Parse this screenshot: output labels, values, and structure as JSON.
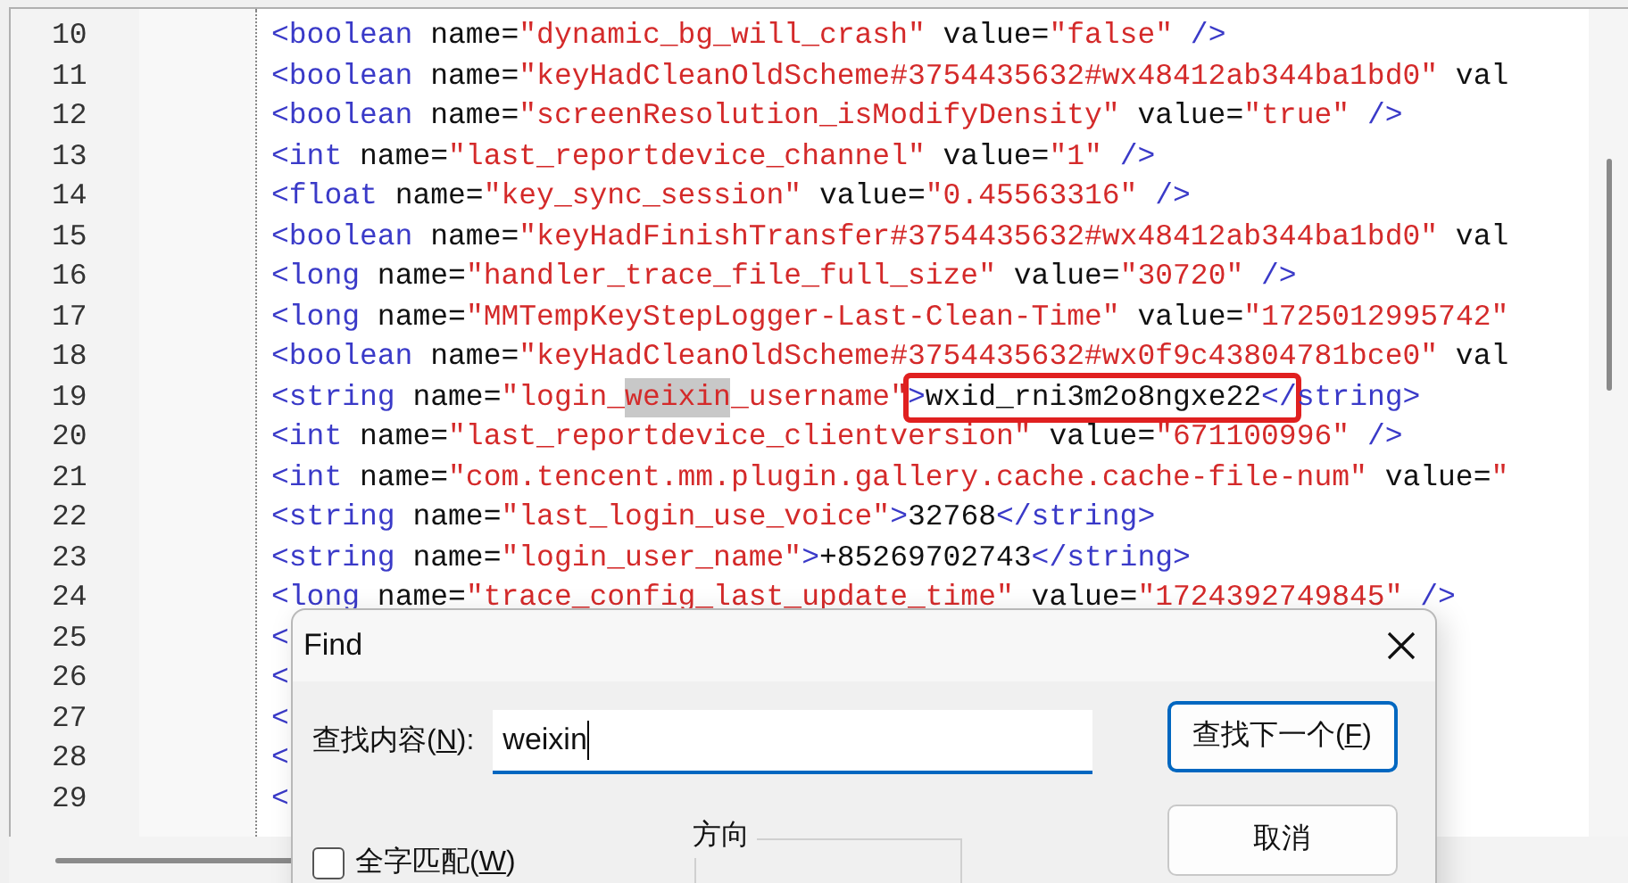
{
  "editor": {
    "lines": [
      {
        "number": "10",
        "parts": [
          {
            "text": "<boolean name=\"dynamic_bg_will_crash\" value=\"false\" />",
            "search_match": false,
            "boxed": false
          }
        ]
      },
      {
        "number": "11",
        "parts": [
          {
            "text": "<boolean name=\"keyHadCleanOldScheme#3754435632#wx48412ab344ba1bd0\" val",
            "search_match": false,
            "boxed": false
          }
        ]
      },
      {
        "number": "12",
        "parts": [
          {
            "text": "<boolean name=\"screenResolution_isModifyDensity\" value=\"true\" />",
            "search_match": false,
            "boxed": false
          }
        ]
      },
      {
        "number": "13",
        "parts": [
          {
            "text": "<int name=\"last_reportdevice_channel\" value=\"1\" />",
            "search_match": false,
            "boxed": false
          }
        ]
      },
      {
        "number": "14",
        "parts": [
          {
            "text": "<float name=\"key_sync_session\" value=\"0.45563316\" />",
            "search_match": false,
            "boxed": false
          }
        ]
      },
      {
        "number": "15",
        "parts": [
          {
            "text": "<boolean name=\"keyHadFinishTransfer#3754435632#wx48412ab344ba1bd0\" val",
            "search_match": false,
            "boxed": false
          }
        ]
      },
      {
        "number": "16",
        "parts": [
          {
            "text": "<long name=\"handler_trace_file_full_size\" value=\"30720\" />",
            "search_match": false,
            "boxed": false
          }
        ]
      },
      {
        "number": "17",
        "parts": [
          {
            "text": "<long name=\"MMTempKeyStepLogger-Last-Clean-Time\" value=\"1725012995742\"",
            "search_match": false,
            "boxed": false
          }
        ]
      },
      {
        "number": "18",
        "parts": [
          {
            "text": "<boolean name=\"keyHadCleanOldScheme#3754435632#wx0f9c43804781bce0\" val",
            "search_match": false,
            "boxed": false
          }
        ]
      },
      {
        "number": "19",
        "parts": [
          {
            "text": "<string name=\"login_",
            "search_match": false,
            "boxed": false
          },
          {
            "text": "weixin",
            "search_match": true,
            "boxed": false
          },
          {
            "text": "_username\"",
            "search_match": false,
            "boxed": false
          },
          {
            "text": ">wxid_rni3m2o8ngxe22</",
            "search_match": false,
            "boxed": true
          },
          {
            "text": "string>",
            "search_match": false,
            "boxed": false
          }
        ]
      },
      {
        "number": "20",
        "parts": [
          {
            "text": "<int name=\"last_reportdevice_clientversion\" value=\"671100996\" />",
            "search_match": false,
            "boxed": false
          }
        ]
      },
      {
        "number": "21",
        "parts": [
          {
            "text": "<int name=\"com.tencent.mm.plugin.gallery.cache.cache-file-num\" value=\"",
            "search_match": false,
            "boxed": false
          }
        ]
      },
      {
        "number": "22",
        "parts": [
          {
            "text": "<string name=\"last_login_use_voice\">32768</string>",
            "search_match": false,
            "boxed": false
          }
        ]
      },
      {
        "number": "23",
        "parts": [
          {
            "text": "<string name=\"login_user_name\">+85269702743</string>",
            "search_match": false,
            "boxed": false
          }
        ]
      },
      {
        "number": "24",
        "parts": [
          {
            "text": "<long name=\"trace_config_last_update_time\" value=\"1724392749845\" />",
            "search_match": false,
            "boxed": false
          }
        ]
      },
      {
        "number": "25",
        "parts": [
          {
            "text": "<",
            "search_match": false,
            "boxed": false
          }
        ]
      },
      {
        "number": "26",
        "parts": [
          {
            "text": "<",
            "search_match": false,
            "boxed": false
          }
        ]
      },
      {
        "number": "27",
        "parts": [
          {
            "text": "<",
            "search_match": false,
            "boxed": false
          }
        ]
      },
      {
        "number": "28",
        "parts": [
          {
            "text": "<",
            "search_match": false,
            "boxed": false
          }
        ]
      },
      {
        "number": "29",
        "parts": [
          {
            "text": "<",
            "search_match": false,
            "boxed": false
          }
        ]
      }
    ]
  },
  "find_dialog": {
    "title": "Find",
    "find_label": {
      "before": "查找内容(",
      "key": "N",
      "after": "):"
    },
    "find_value": "weixin",
    "find_next_button": {
      "before": "查找下一个(",
      "key": "F",
      "after": ")"
    },
    "whole_word": {
      "before": "全字匹配(",
      "key": "W",
      "after": ")",
      "checked": false
    },
    "direction_label": "方向",
    "cancel_button": "取消"
  }
}
